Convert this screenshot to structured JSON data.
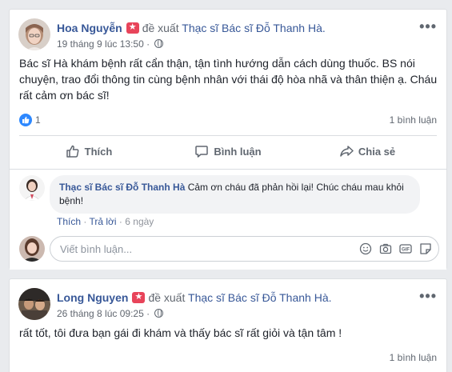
{
  "post1": {
    "author": "Hoa Nguyễn",
    "recommends": "đề xuất",
    "page_name": "Thạc sĩ Bác sĩ Đỗ Thanh Hà.",
    "timestamp": "19 tháng 9 lúc 13:50",
    "more": "•••",
    "text": "Bác sĩ Hà khám bệnh rất cẩn thận, tận tình hướng dẫn cách dùng thuốc. BS nói chuyện, trao đổi thông tin cùng bệnh nhân với thái độ hòa nhã và thân thiện ạ. Cháu rất cảm ơn bác sĩ!",
    "like_count": "1",
    "comment_count": "1 bình luận",
    "actions": {
      "like": "Thích",
      "comment": "Bình luận",
      "share": "Chia sẻ"
    },
    "reply": {
      "author": "Thạc sĩ Bác sĩ Đỗ Thanh Hà",
      "text": "Cảm ơn cháu đã phản hồi lại! Chúc cháu mau khỏi bệnh!",
      "like": "Thích",
      "reply": "Trả lời",
      "time": "6 ngày"
    },
    "comment_placeholder": "Viết bình luận..."
  },
  "post2": {
    "author": "Long Nguyen",
    "recommends": "đề xuất",
    "page_name": "Thạc sĩ Bác sĩ Đỗ Thanh Hà.",
    "timestamp": "26 tháng 8 lúc 09:25",
    "more": "•••",
    "text": "rất tốt, tôi đưa bạn gái đi khám và thấy bác sĩ rất giỏi và tận tâm !",
    "comment_count": "1 bình luận"
  },
  "colors": {
    "link": "#385898",
    "secondary_text": "#606770",
    "badge": "#e8445a",
    "like_blue": "#2d88ff",
    "background": "#e9ebee"
  }
}
